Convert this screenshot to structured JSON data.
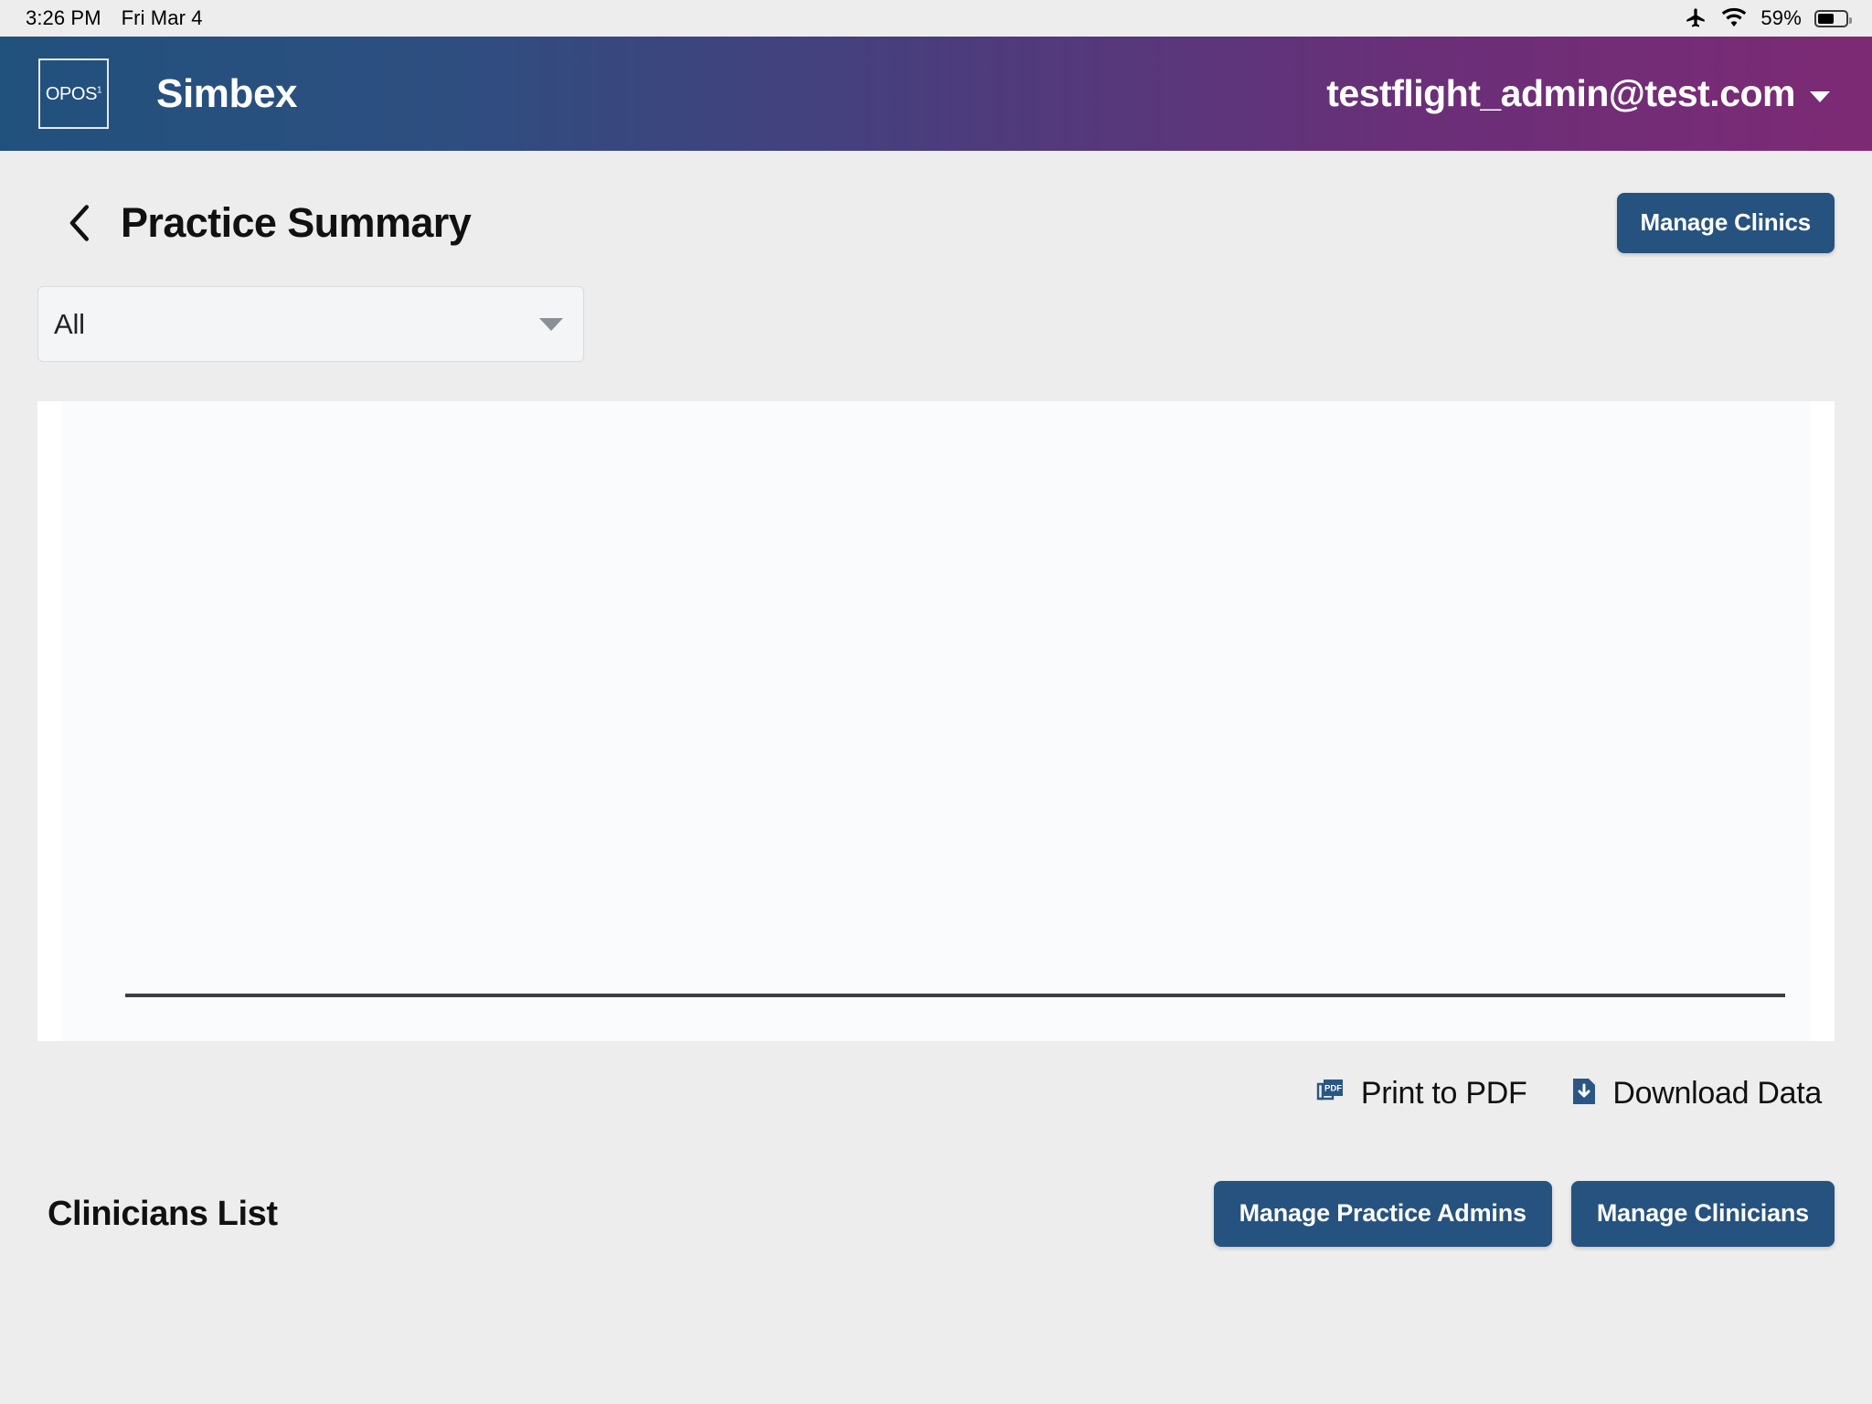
{
  "status_bar": {
    "time": "3:26 PM",
    "date": "Fri Mar 4",
    "airplane_icon": "airplane-icon",
    "wifi_icon": "wifi-icon",
    "battery_percent": "59%",
    "battery_level": 59
  },
  "app_header": {
    "logo_text": "OPOS",
    "logo_superscript": "1",
    "brand": "Simbex",
    "account_email": "testflight_admin@test.com",
    "account_caret_icon": "chevron-down-icon",
    "gradient_start": "#21517d",
    "gradient_end": "#7d2a74"
  },
  "page": {
    "back_icon": "chevron-left-icon",
    "title": "Practice Summary",
    "manage_clinics_label": "Manage Clinics"
  },
  "filter": {
    "selected": "All",
    "caret_icon": "caret-down-icon",
    "options": [
      "All"
    ]
  },
  "chart_data": {
    "type": "bar",
    "title": "",
    "subtitle": "",
    "xlabel": "",
    "ylabel": "",
    "categories": [],
    "values": [],
    "series": [],
    "grid": false,
    "legend": "none",
    "note": "Empty chart area — only the horizontal x-axis baseline is rendered; no bars, ticks, labels, or legend are visible."
  },
  "export": {
    "print_pdf_label": "Print to PDF",
    "print_pdf_icon": "pdf-icon",
    "download_label": "Download Data",
    "download_icon": "download-icon",
    "icon_color": "#2b5684"
  },
  "clinicians": {
    "title": "Clinicians List",
    "manage_practice_admins_label": "Manage Practice Admins",
    "manage_clinicians_label": "Manage Clinicians"
  },
  "colors": {
    "accent_blue": "#26527f",
    "page_background": "#ededed",
    "card_background": "#fafbfd",
    "axis_line": "#3b3d47"
  }
}
